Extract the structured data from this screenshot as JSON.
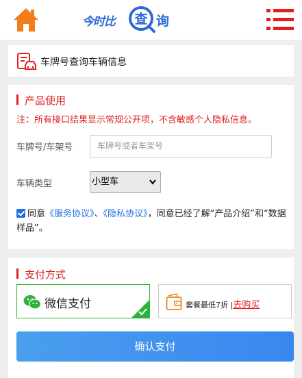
{
  "header": {
    "home_icon": "home-icon",
    "logo": {
      "part1": "今时比",
      "part_big": "查",
      "part2": "询"
    },
    "menu_icon": "menu-icon",
    "colors": {
      "home": "#f07e1d",
      "logo": "#2d6ad6",
      "menu": "#e02020"
    }
  },
  "title_card": {
    "icon": "car-document-icon",
    "title": "车牌号查询车辆信息"
  },
  "form": {
    "section_title": "产品使用",
    "notice": "注：所有接口结果显示常规公开项，不含敏感个人隐私信息。",
    "plate_label": "车牌号/车架号",
    "plate_placeholder": "车牌号或者车架号",
    "type_label": "车辆类型",
    "type_selected": "小型车",
    "agree_prefix": "同意",
    "service_link": "《服务协议》",
    "separator": "、",
    "privacy_link": "《隐私协议》",
    "agree_suffix": "，同意已经了解“产品介绍”和“数据样品”。"
  },
  "payment": {
    "section_title": "支付方式",
    "wechat_label": "微信支付",
    "pack_text": "套餐最低7折",
    "pack_sep": "|",
    "buy_link": "去购买",
    "confirm_label": "确认支付",
    "colors": {
      "accent_red": "#e02020",
      "wechat_green": "#2db33a",
      "button_blue": "#3a86f0"
    }
  }
}
